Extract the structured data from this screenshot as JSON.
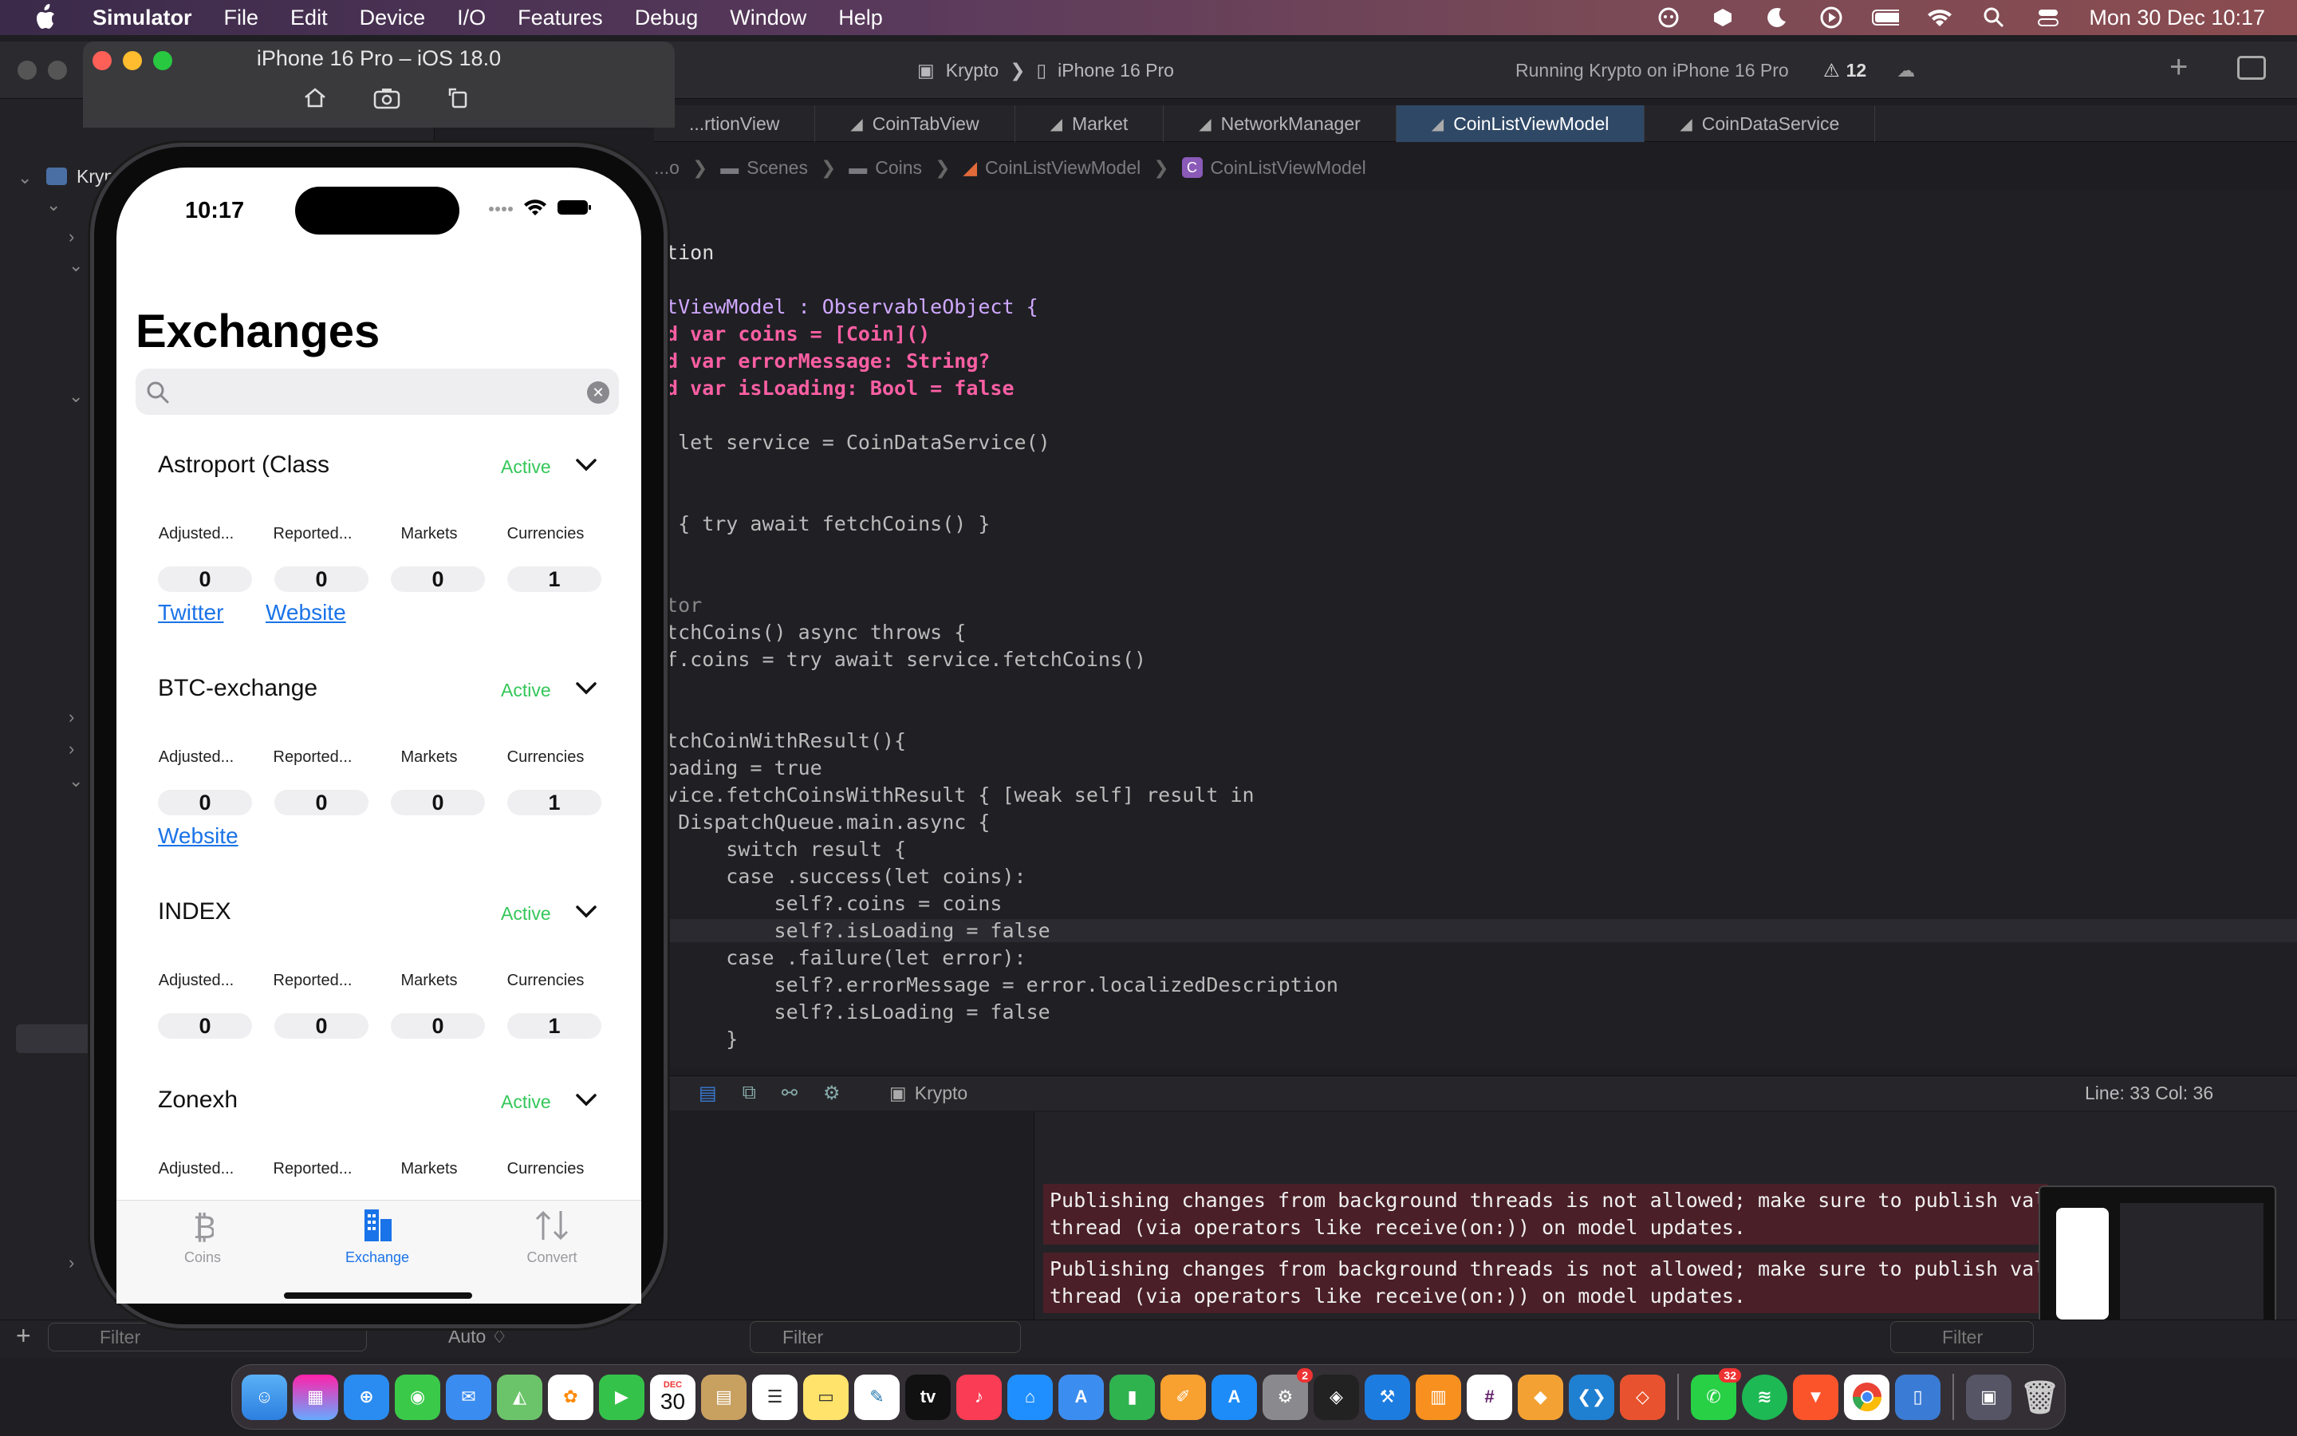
{
  "menubar": {
    "app_name": "Simulator",
    "items": [
      "File",
      "Edit",
      "Device",
      "I/O",
      "Features",
      "Debug",
      "Window",
      "Help"
    ],
    "clock": "Mon 30 Dec  10:17"
  },
  "xcode": {
    "scheme_project": "Krypto",
    "scheme_device": "iPhone 16 Pro",
    "status_text": "Running Krypto on iPhone 16 Pro",
    "warning_count": "12",
    "sidebar_root": "Krypt",
    "tabs": [
      {
        "label": "...rtionView",
        "active": false
      },
      {
        "label": "CoinTabView",
        "active": false
      },
      {
        "label": "Market",
        "active": false
      },
      {
        "label": "NetworkManager",
        "active": false
      },
      {
        "label": "CoinListViewModel",
        "active": true
      },
      {
        "label": "CoinDataService",
        "active": false
      }
    ],
    "breadcrumb": [
      "...o",
      "Scenes",
      "Coins",
      "CoinListViewModel",
      "CoinListViewModel"
    ],
    "breadcrumb_badge": "C",
    "code_lines": [
      {
        "text": "ation"
      },
      {
        "text": ""
      },
      {
        "text": "stViewModel : ObservableObject {"
      },
      {
        "text": "ed var coins = [Coin]()"
      },
      {
        "text": "ed var errorMessage: String?"
      },
      {
        "text": "ed var isLoading: Bool = false"
      },
      {
        "text": ""
      },
      {
        "text": "e let service = CoinDataService()"
      },
      {
        "text": ""
      },
      {
        "text": "{"
      },
      {
        "text": "k { try await fetchCoins() }"
      },
      {
        "text": ""
      },
      {
        "text": ""
      },
      {
        "text": "ctor"
      },
      {
        "text": "etchCoins() async throws {"
      },
      {
        "text": "lf.coins = try await service.fetchCoins()"
      },
      {
        "text": ""
      },
      {
        "text": ""
      },
      {
        "text": "etchCoinWithResult(){"
      },
      {
        "text": "Loading = true"
      },
      {
        "text": "rvice.fetchCoinsWithResult { [weak self] result in"
      },
      {
        "text": "  DispatchQueue.main.async {"
      },
      {
        "text": "      switch result {"
      },
      {
        "text": "      case .success(let coins):"
      },
      {
        "text": "          self?.coins = coins"
      },
      {
        "text": "          self?.isLoading = false"
      },
      {
        "text": "      case .failure(let error):"
      },
      {
        "text": "          self?.errorMessage = error.localizedDescription"
      },
      {
        "text": "          self?.isLoading = false"
      },
      {
        "text": "      }"
      },
      {
        "text": "  }"
      }
    ],
    "debug_target": "Krypto",
    "line_col": "Line: 33  Col: 36",
    "console_messages": [
      "Publishing changes from background threads is not allowed; make sure to publish valu\nthread (via operators like receive(on:)) on model updates.",
      "Publishing changes from background threads is not allowed; make sure to publish valu\nthread (via operators like receive(on:)) on model updates."
    ],
    "filter_placeholder": "Filter",
    "auto_label": "Auto ♢"
  },
  "simulator": {
    "title": "iPhone 16 Pro – iOS 18.0",
    "status_time": "10:17",
    "screen_title": "Exchanges",
    "search_placeholder": "",
    "search_value": "",
    "column_labels": [
      "Adjusted...",
      "Reported...",
      "Markets",
      "Currencies"
    ],
    "exchanges": [
      {
        "name": "Astroport (Class",
        "status": "Active",
        "values": [
          "0",
          "0",
          "0",
          "1"
        ],
        "links": [
          "Twitter",
          "Website"
        ]
      },
      {
        "name": "BTC-exchange",
        "status": "Active",
        "values": [
          "0",
          "0",
          "0",
          "1"
        ],
        "links": [
          "Website"
        ]
      },
      {
        "name": "INDEX",
        "status": "Active",
        "values": [
          "0",
          "0",
          "0",
          "1"
        ],
        "links": []
      },
      {
        "name": "Zonexh",
        "status": "Active",
        "values": [],
        "links": []
      }
    ],
    "tabbar": [
      {
        "label": "Coins",
        "icon": "bitcoin-icon",
        "active": false
      },
      {
        "label": "Exchange",
        "icon": "building-icon",
        "active": true
      },
      {
        "label": "Convert",
        "icon": "arrows-updown-icon",
        "active": false
      }
    ],
    "colors": {
      "active_status": "#34c759",
      "link": "#1a73e8",
      "tab_active": "#1a73e8"
    }
  },
  "dock": {
    "calendar_month": "DEC",
    "calendar_day": "30",
    "badge_settings": "2",
    "badge_whatsapp": "32",
    "apps": [
      "finder-icon",
      "launchpad-icon",
      "safari-icon",
      "messages-icon",
      "mail-icon",
      "maps-icon",
      "photos-icon",
      "facetime-icon",
      "calendar-icon",
      "notes-icon",
      "reminders-icon",
      "stickies-icon",
      "freeform-icon",
      "tv-icon",
      "music-icon",
      "keynote-icon",
      "instruments-icon",
      "numbers-icon",
      "pages-icon",
      "appstore-icon",
      "settings-icon",
      "figma-icon",
      "xcode-icon",
      "books-icon",
      "slack-icon",
      "sketch-icon",
      "vscode-icon",
      "git-icon",
      "whatsapp-icon",
      "spotify-icon",
      "brave-icon",
      "chrome-icon",
      "simulator-icon",
      "preview-icon",
      "trash-icon"
    ]
  }
}
